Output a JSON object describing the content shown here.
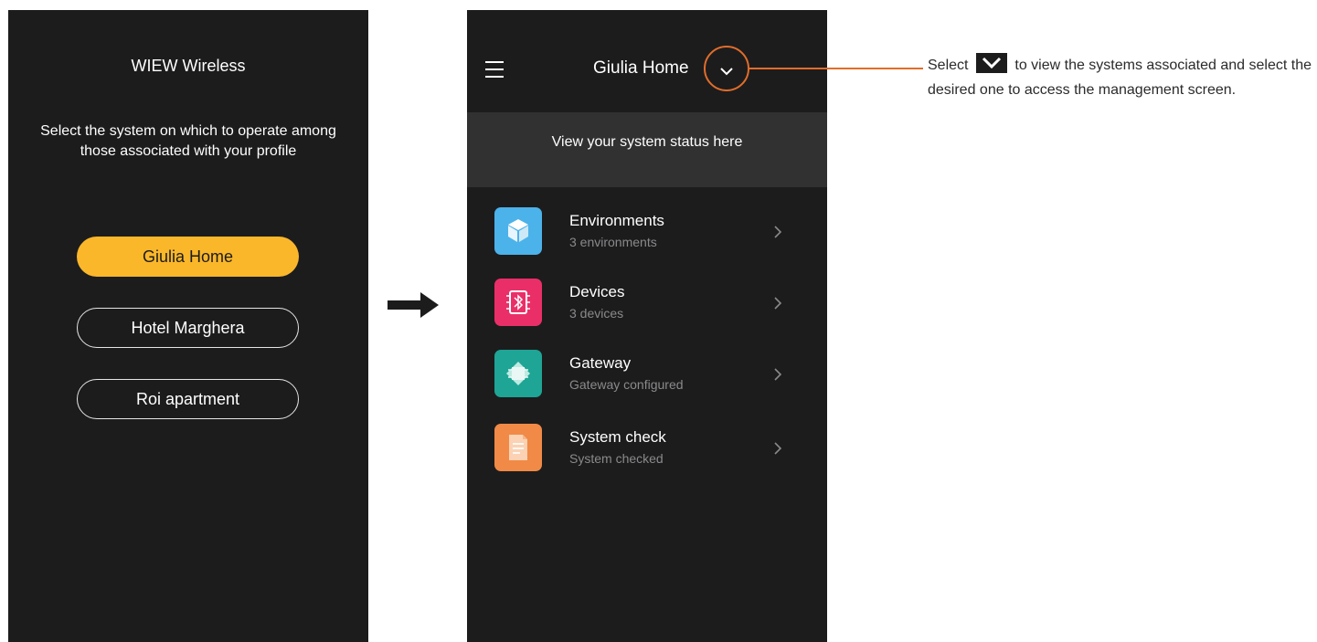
{
  "left_screen": {
    "title": "WIEW Wireless",
    "instructions": "Select the system on which to operate among those associated with your profile",
    "systems": [
      {
        "label": "Giulia Home",
        "selected": true
      },
      {
        "label": "Hotel Marghera",
        "selected": false
      },
      {
        "label": "Roi apartment",
        "selected": false
      }
    ]
  },
  "right_screen": {
    "header_title": "Giulia Home",
    "status_text": "View your system status here",
    "menu_items": [
      {
        "title": "Environments",
        "subtitle": "3 environments",
        "icon": "cube-icon",
        "icon_color": "#4cb2ea"
      },
      {
        "title": "Devices",
        "subtitle": "3 devices",
        "icon": "bluetooth-chip-icon",
        "icon_color": "#ea2f68"
      },
      {
        "title": "Gateway",
        "subtitle": "Gateway configured",
        "icon": "gateway-chip-icon",
        "icon_color": "#1ea595"
      },
      {
        "title": "System check",
        "subtitle": "System checked",
        "icon": "document-icon",
        "icon_color": "#f08a46"
      }
    ]
  },
  "callout": {
    "text_before": "Select",
    "text_after": "to view the systems associated and select the desired one to access the management screen.",
    "highlight_color": "#e06d2a"
  },
  "colors": {
    "phone_background": "#1c1c1d",
    "status_panel": "#313132",
    "selected_button": "#fbb72a"
  }
}
